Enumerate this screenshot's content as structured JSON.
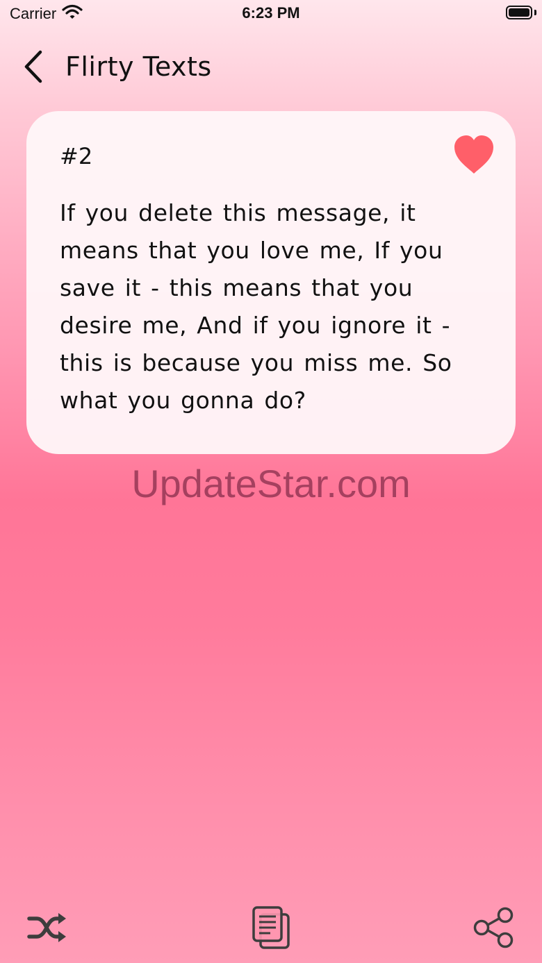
{
  "status_bar": {
    "carrier": "Carrier",
    "time": "6:23 PM"
  },
  "nav": {
    "title": "Flirty Texts"
  },
  "card": {
    "number": "#2",
    "text": "If you delete this message, it means that you love me, If you save it - this means that you desire me, And if you ignore it - this is because you miss me. So what you gonna do?",
    "favorite_color": "#ff5f69"
  },
  "watermark": {
    "text": "UpdateStar.com"
  },
  "toolbar": {
    "icons": [
      "shuffle-icon",
      "copy-icon",
      "share-icon"
    ],
    "icon_color": "#3d3d3d"
  }
}
